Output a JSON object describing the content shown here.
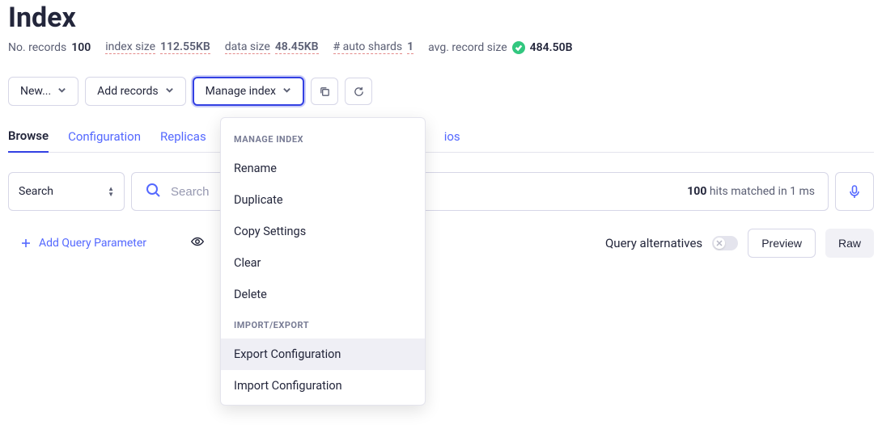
{
  "page": {
    "title": "Index"
  },
  "stats": {
    "records_label": "No. records",
    "records_value": "100",
    "index_size_label": "index size",
    "index_size_value": "112.55KB",
    "data_size_label": "data size",
    "data_size_value": "48.45KB",
    "auto_shards_label": "# auto shards",
    "auto_shards_value": "1",
    "avg_record_label": "avg. record size",
    "avg_record_value": "484.50B"
  },
  "toolbar": {
    "new_label": "New...",
    "add_records_label": "Add records",
    "manage_index_label": "Manage index"
  },
  "tabs": {
    "browse": "Browse",
    "configuration": "Configuration",
    "replicas": "Replicas",
    "trailing": "ios"
  },
  "search": {
    "filter_label": "Search",
    "placeholder": "Search",
    "hits_count": "100",
    "hits_text": " hits matched in 1 ms"
  },
  "under": {
    "add_query_param": "Add Query Parameter",
    "query_alternatives": "Query alternatives",
    "preview": "Preview",
    "raw": "Raw"
  },
  "dropdown": {
    "header_manage": "MANAGE INDEX",
    "rename": "Rename",
    "duplicate": "Duplicate",
    "copy_settings": "Copy Settings",
    "clear": "Clear",
    "delete": "Delete",
    "header_io": "IMPORT/EXPORT",
    "export_config": "Export Configuration",
    "import_config": "Import Configuration"
  }
}
